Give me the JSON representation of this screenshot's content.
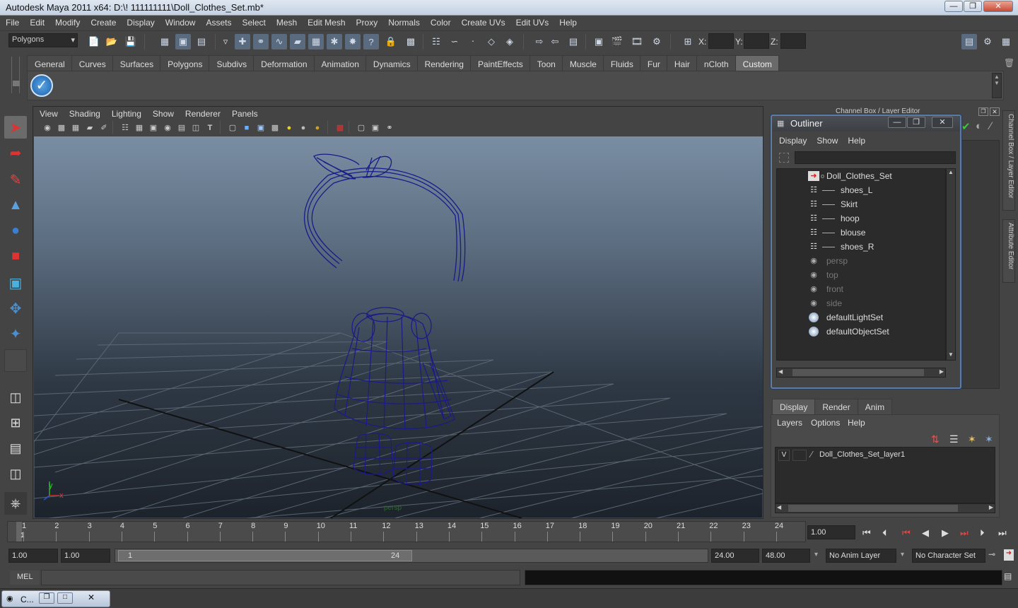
{
  "window": {
    "title": "Autodesk Maya 2011 x64: D:\\! 111111111\\Doll_Clothes_Set.mb*"
  },
  "menubar": [
    "File",
    "Edit",
    "Modify",
    "Create",
    "Display",
    "Window",
    "Assets",
    "Select",
    "Mesh",
    "Edit Mesh",
    "Proxy",
    "Normals",
    "Color",
    "Create UVs",
    "Edit UVs",
    "Help"
  ],
  "status_line": {
    "menu_set": "Polygons",
    "x_label": "X:",
    "y_label": "Y:",
    "z_label": "Z:"
  },
  "shelf": {
    "tabs": [
      "General",
      "Curves",
      "Surfaces",
      "Polygons",
      "Subdivs",
      "Deformation",
      "Animation",
      "Dynamics",
      "Rendering",
      "PaintEffects",
      "Toon",
      "Muscle",
      "Fluids",
      "Fur",
      "Hair",
      "nCloth",
      "Custom"
    ],
    "active_tab": "Custom"
  },
  "viewport": {
    "menu": [
      "View",
      "Shading",
      "Lighting",
      "Show",
      "Renderer",
      "Panels"
    ],
    "camera_label": "persp",
    "axis_y": "y",
    "axis_x": "x"
  },
  "right_panel": {
    "channel_box_title": "Channel Box / Layer Editor",
    "side_tab_1": "Channel Box / Layer Editor",
    "side_tab_2": "Attribute Editor"
  },
  "outliner": {
    "title": "Outliner",
    "menu": [
      "Display",
      "Show",
      "Help"
    ],
    "items": [
      {
        "label": "Doll_Clothes_Set",
        "icon": "transform-icon",
        "dim": false
      },
      {
        "label": "shoes_L",
        "icon": "mesh-icon",
        "dim": false
      },
      {
        "label": "Skirt",
        "icon": "mesh-icon",
        "dim": false
      },
      {
        "label": "hoop",
        "icon": "mesh-icon",
        "dim": false
      },
      {
        "label": "blouse",
        "icon": "mesh-icon",
        "dim": false
      },
      {
        "label": "shoes_R",
        "icon": "mesh-icon",
        "dim": false
      },
      {
        "label": "persp",
        "icon": "camera-icon",
        "dim": true
      },
      {
        "label": "top",
        "icon": "camera-icon",
        "dim": true
      },
      {
        "label": "front",
        "icon": "camera-icon",
        "dim": true
      },
      {
        "label": "side",
        "icon": "camera-icon",
        "dim": true
      },
      {
        "label": "defaultLightSet",
        "icon": "set-icon",
        "dim": false
      },
      {
        "label": "defaultObjectSet",
        "icon": "set-icon",
        "dim": false
      }
    ]
  },
  "layer_editor": {
    "tabs": [
      "Display",
      "Render",
      "Anim"
    ],
    "active_tab": "Display",
    "menu": [
      "Layers",
      "Options",
      "Help"
    ],
    "layers": [
      {
        "visible": "V",
        "name": "Doll_Clothes_Set_layer1"
      }
    ]
  },
  "time_slider": {
    "ticks": [
      "1",
      "2",
      "3",
      "4",
      "5",
      "6",
      "7",
      "8",
      "9",
      "10",
      "11",
      "12",
      "13",
      "14",
      "15",
      "16",
      "17",
      "18",
      "19",
      "20",
      "21",
      "22",
      "23",
      "24"
    ],
    "current_frame": "1.00",
    "current_marker": "1"
  },
  "range_slider": {
    "start_time": "1.00",
    "playback_start": "1.00",
    "range_start_label": "1",
    "range_end_label": "24",
    "playback_end": "24.00",
    "end_time": "48.00",
    "anim_layer": "No Anim Layer",
    "character_set": "No Character Set"
  },
  "command_line": {
    "label": "MEL"
  },
  "taskbar": {
    "minimized_label": "C..."
  }
}
